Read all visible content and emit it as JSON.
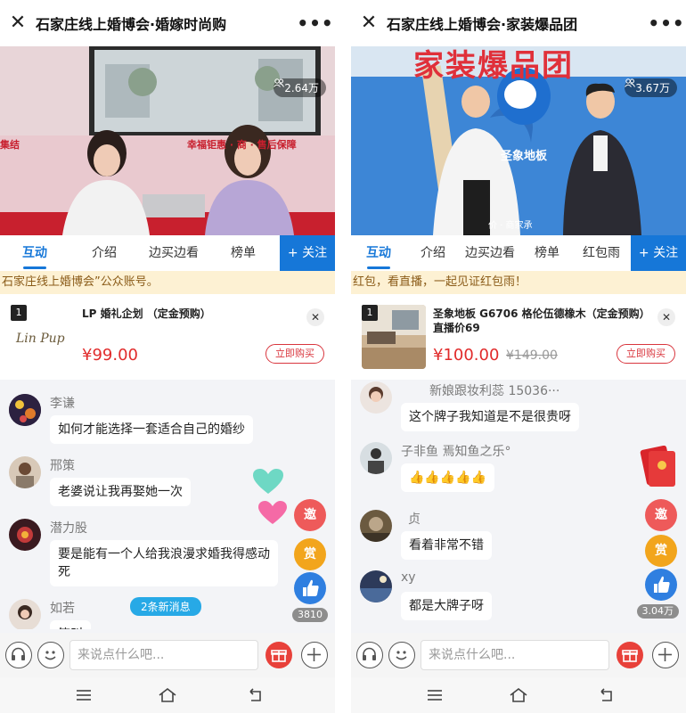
{
  "left": {
    "title": "石家庄线上婚博会·婚嫁时尚购",
    "viewers": "2.64万",
    "tabs": [
      "互动",
      "介绍",
      "边买边看",
      "榜单"
    ],
    "follow": "+ 关注",
    "notice": "石家庄线上婚博会”公众账号。",
    "product": {
      "index": "1",
      "name": "LP 婚礼企划 （定金预购）",
      "price": "¥99.00",
      "buy": "立即购买",
      "logo_text": "Lin Pup"
    },
    "messages": [
      {
        "user": "李谦",
        "text": "如何才能选择一套适合自己的婚纱"
      },
      {
        "user": "邢策",
        "text": "老婆说让我再娶她一次"
      },
      {
        "user": "潜力股",
        "text": "要是能有一个人给我浪漫求婚我得感动死"
      },
      {
        "user": "如若",
        "text": "笑叫"
      }
    ],
    "new_messages": "2条新消息",
    "side": {
      "invite": "邀",
      "reward": "赏",
      "likes": "3810"
    },
    "input_placeholder": "来说点什么吧...",
    "video_banner": "幸福钜惠 · 商 · 售后保障",
    "video_banner_left": "集结"
  },
  "right": {
    "title": "石家庄线上婚博会·家装爆品团",
    "viewers": "3.67万",
    "tabs": [
      "互动",
      "介绍",
      "边买边看",
      "榜单",
      "红包雨"
    ],
    "follow": "+ 关注",
    "notice": "红包，看直播，一起见证红包雨！",
    "product": {
      "index": "1",
      "name": "圣象地板 G6706 格伦伍德橡木（定金预购）直播价69",
      "price": "¥100.00",
      "original_price": "¥149.00",
      "buy": "立即购买"
    },
    "messages": [
      {
        "user": "新娘跟妆利蕊 15036···",
        "text": "这个牌子我知道是不是很贵呀"
      },
      {
        "user": "子非鱼 焉知鱼之乐°",
        "text": "👍👍👍👍👍"
      },
      {
        "user": "贞",
        "text": "看着非常不错"
      },
      {
        "user": "xy",
        "text": "都是大牌子呀"
      }
    ],
    "side": {
      "invite": "邀",
      "reward": "赏",
      "likes": "3.04万"
    },
    "input_placeholder": "来说点什么吧...",
    "video_banner": "家装爆品团",
    "brand": "圣象地板",
    "video_sub": "价 · 商家承"
  },
  "colors": {
    "accent": "#1677d8",
    "price": "#e12b2b",
    "notice_bg": "#fdf1d3",
    "new_msg": "#27a9e6"
  }
}
